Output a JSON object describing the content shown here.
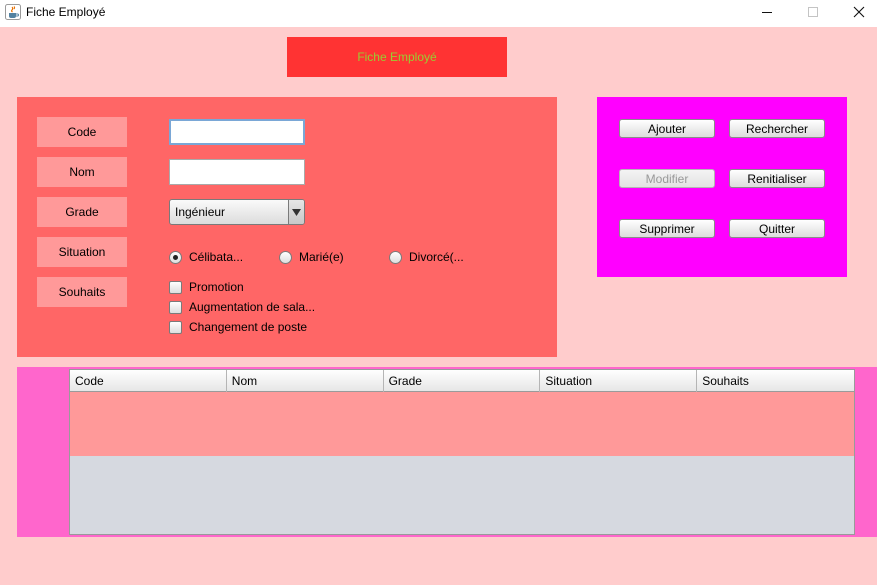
{
  "window": {
    "title": "Fiche Employé"
  },
  "banner": {
    "text": "Fiche Employé",
    "text_color": "#9acd32",
    "background": "#ff3333"
  },
  "form": {
    "labels": {
      "code": "Code",
      "nom": "Nom",
      "grade": "Grade",
      "situation": "Situation",
      "souhaits": "Souhaits"
    },
    "code_value": "",
    "nom_value": "",
    "grade_selected": "Ingénieur",
    "situation_options": [
      {
        "label": "Célibata...",
        "selected": true
      },
      {
        "label": "Marié(e)",
        "selected": false
      },
      {
        "label": "Divorcé(...",
        "selected": false
      }
    ],
    "souhaits_options": [
      {
        "label": "Promotion",
        "checked": false
      },
      {
        "label": "Augmentation de sala...",
        "checked": false
      },
      {
        "label": "Changement de poste",
        "checked": false
      }
    ]
  },
  "actions": {
    "ajouter": "Ajouter",
    "rechercher": "Rechercher",
    "modifier": "Modifier",
    "reinitialiser": "Renitialiser",
    "supprimer": "Supprimer",
    "quitter": "Quitter"
  },
  "table": {
    "columns": [
      "Code",
      "Nom",
      "Grade",
      "Situation",
      "Souhaits"
    ],
    "rows": []
  },
  "colors": {
    "background": "#ffcccc",
    "form_panel": "#ff6666",
    "label_box": "#ff9999",
    "button_panel": "#ff00ff",
    "table_panel": "#ff66cc"
  },
  "icons": {
    "app": "java-cup-icon",
    "minimize": "minimize-icon",
    "maximize": "maximize-icon",
    "close": "close-icon",
    "combo_arrow": "triangle-down-icon"
  }
}
